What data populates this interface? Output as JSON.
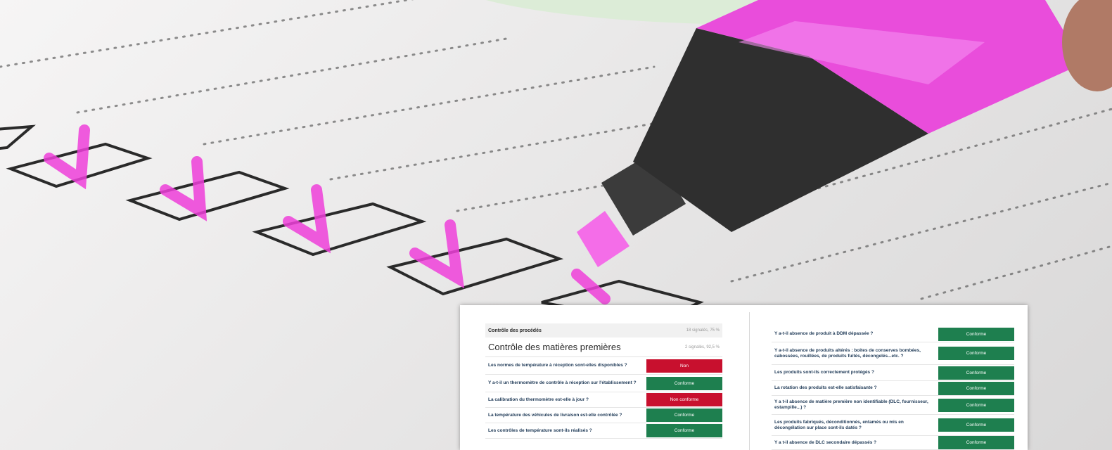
{
  "report": {
    "left": {
      "section_header": {
        "label": "Contrôle des procédés",
        "meta": "18 signalés, 75 %"
      },
      "section_title": {
        "label": "Contrôle des matières premières",
        "meta": "2 signalés, 92,5 %"
      },
      "rows": [
        {
          "question": "Les normes de température à réception sont-elles disponibles ?",
          "answer": "Non",
          "status": "ko"
        },
        {
          "question": "Y a-t-il un thermomètre de contrôle à réception sur l'établissement ?",
          "answer": "Conforme",
          "status": "ok"
        },
        {
          "question": "La calibration du thermomètre est-elle à jour ?",
          "answer": "Non conforme",
          "status": "ko"
        },
        {
          "question": "La température des véhicules de livraison est-elle contrôlée ?",
          "answer": "Conforme",
          "status": "ok"
        },
        {
          "question": "Les contrôles de température sont-ils réalisés ?",
          "answer": "Conforme",
          "status": "ok"
        }
      ]
    },
    "right": {
      "rows": [
        {
          "question": "Y a-t-il absence de produit à DDM dépassée ?",
          "answer": "Conforme",
          "status": "ok"
        },
        {
          "question": "Y a-t-il absence de produits altérés : boites de conserves bombées, cabossées, rouillées, de produits fuités, décongelés...etc. ?",
          "answer": "Conforme",
          "status": "ok"
        },
        {
          "question": "Les produits sont-ils correctement protégés ?",
          "answer": "Conforme",
          "status": "ok"
        },
        {
          "question": "La rotation des produits est-elle satisfaisante ?",
          "answer": "Conforme",
          "status": "ok"
        },
        {
          "question": "Y a t-il absence de matière première non identifiable (DLC, fournisseur, estampille...) ?",
          "answer": "Conforme",
          "status": "ok"
        },
        {
          "question": "Les produits fabriqués, déconditionnés, entamés ou mis en décongélation sur place sont-ils datés ?",
          "answer": "Conforme",
          "status": "ok"
        },
        {
          "question": "Y a t-il absence de DLC secondaire dépassés ?",
          "answer": "Conforme",
          "status": "ok"
        }
      ]
    }
  },
  "colors": {
    "ok": "#1e7f4f",
    "ko": "#c8102e",
    "highlighter": "#f04ae0",
    "band": "#dcecd7"
  },
  "background": {
    "icons": [
      "checkbox-icon",
      "checkmark-icon",
      "highlighter-icon"
    ]
  }
}
